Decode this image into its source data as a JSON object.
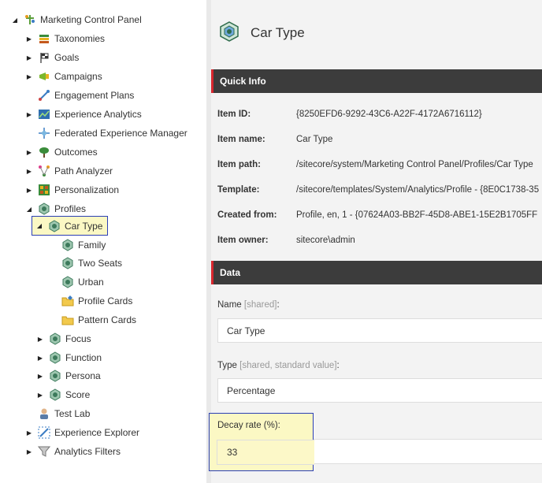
{
  "tree": {
    "root": {
      "label": "Marketing Control Panel",
      "icon": "marketing-control-panel-icon"
    },
    "items": [
      {
        "id": "taxonomies",
        "label": "Taxonomies",
        "icon": "taxonomies-icon",
        "expander": "collapsed"
      },
      {
        "id": "goals",
        "label": "Goals",
        "icon": "goals-icon",
        "expander": "collapsed"
      },
      {
        "id": "campaigns",
        "label": "Campaigns",
        "icon": "campaigns-icon",
        "expander": "collapsed"
      },
      {
        "id": "engagement-plans",
        "label": "Engagement Plans",
        "icon": "engagement-plans-icon",
        "expander": "none"
      },
      {
        "id": "experience-analytics",
        "label": "Experience Analytics",
        "icon": "experience-analytics-icon",
        "expander": "collapsed"
      },
      {
        "id": "federated-experience-manager",
        "label": "Federated Experience Manager",
        "icon": "federated-experience-manager-icon",
        "expander": "none"
      },
      {
        "id": "outcomes",
        "label": "Outcomes",
        "icon": "outcomes-icon",
        "expander": "collapsed"
      },
      {
        "id": "path-analyzer",
        "label": "Path Analyzer",
        "icon": "path-analyzer-icon",
        "expander": "collapsed"
      },
      {
        "id": "personalization",
        "label": "Personalization",
        "icon": "personalization-icon",
        "expander": "collapsed"
      },
      {
        "id": "profiles",
        "label": "Profiles",
        "icon": "profile-icon",
        "expander": "expanded"
      }
    ],
    "selected": {
      "label": "Car Type",
      "icon": "profile-icon",
      "expander": "expanded"
    },
    "car_type_children": [
      {
        "label": "Family",
        "icon": "profile-key-icon"
      },
      {
        "label": "Two Seats",
        "icon": "profile-key-icon"
      },
      {
        "label": "Urban",
        "icon": "profile-key-icon"
      },
      {
        "label": "Profile Cards",
        "icon": "profile-cards-folder-icon"
      },
      {
        "label": "Pattern Cards",
        "icon": "pattern-cards-folder-icon"
      }
    ],
    "profile_siblings": [
      {
        "label": "Focus",
        "icon": "profile-icon",
        "expander": "collapsed"
      },
      {
        "label": "Function",
        "icon": "profile-icon",
        "expander": "collapsed"
      },
      {
        "label": "Persona",
        "icon": "profile-icon",
        "expander": "collapsed"
      },
      {
        "label": "Score",
        "icon": "profile-icon",
        "expander": "collapsed"
      }
    ],
    "after_profiles": [
      {
        "label": "Test Lab",
        "icon": "test-lab-icon",
        "expander": "none"
      },
      {
        "label": "Experience Explorer",
        "icon": "experience-explorer-icon",
        "expander": "collapsed"
      },
      {
        "label": "Analytics Filters",
        "icon": "analytics-filters-icon",
        "expander": "collapsed"
      }
    ]
  },
  "editor": {
    "title": "Car Type",
    "title_icon": "profile-icon",
    "quick_info": {
      "header": "Quick Info",
      "rows": [
        {
          "label": "Item ID:",
          "value": "{8250EFD6-9292-43C6-A22F-4172A6716112}"
        },
        {
          "label": "Item name:",
          "value": "Car Type"
        },
        {
          "label": "Item path:",
          "value": "/sitecore/system/Marketing Control Panel/Profiles/Car Type"
        },
        {
          "label": "Template:",
          "value": "/sitecore/templates/System/Analytics/Profile - {8E0C1738-35"
        },
        {
          "label": "Created from:",
          "value": "Profile, en, 1 - {07624A03-BB2F-45D8-ABE1-15E2B1705FF"
        },
        {
          "label": "Item owner:",
          "value": "sitecore\\admin"
        }
      ]
    },
    "data": {
      "header": "Data",
      "fields": [
        {
          "label": "Name",
          "meta": "[shared]",
          "suffix": ":",
          "value": "Car Type"
        },
        {
          "label": "Type",
          "meta": "[shared, standard value]",
          "suffix": ":",
          "value": "Percentage"
        }
      ],
      "decay": {
        "label": "Decay rate (%):",
        "value": "33"
      }
    }
  },
  "colors": {
    "section_bar": "#3c3c3c",
    "section_accent": "#d8262e",
    "highlight_fill": "#fbf8c4",
    "highlight_border": "#2b3fb5"
  }
}
